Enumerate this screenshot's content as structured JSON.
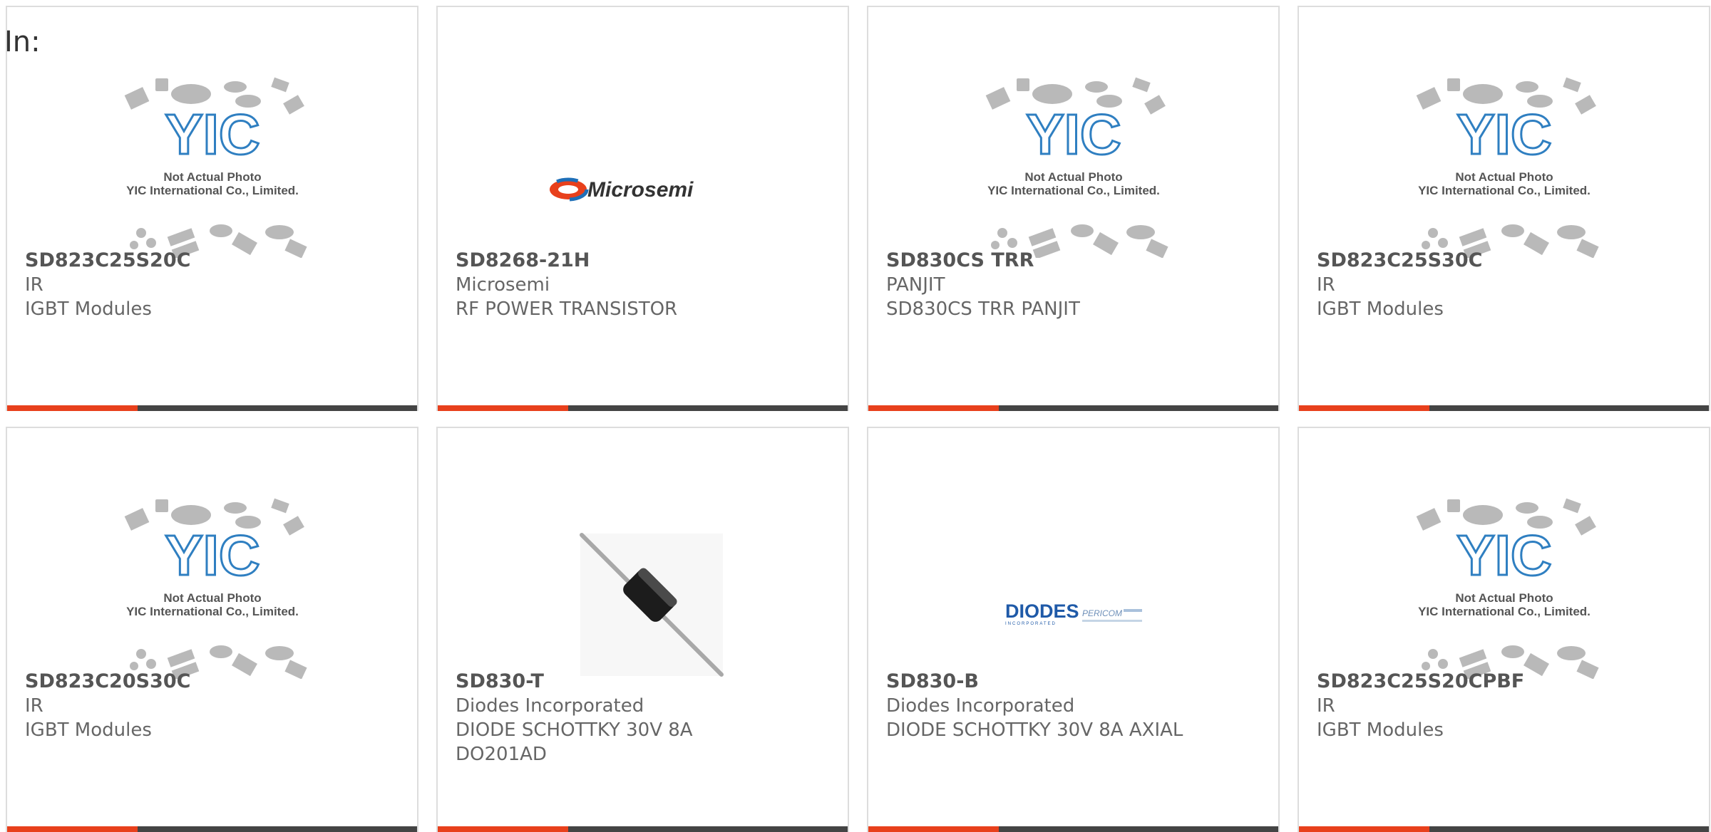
{
  "header": {
    "filter_label": "In:"
  },
  "colors": {
    "accent": "#e8401c",
    "bar": "#444444",
    "border": "#dddddd",
    "text": "#666666"
  },
  "placeholder": {
    "line1": "Not Actual Photo",
    "line2": "YIC International Co., Limited.",
    "logo_text": "YIC"
  },
  "brand_logos": {
    "microsemi": "Microsemi",
    "diodes": "DIODES",
    "diodes_sub": "INCORPORATED",
    "pericom": "PERICOM"
  },
  "products": [
    {
      "part_number": "SD823C25S20C",
      "manufacturer": "IR",
      "description": "IGBT Modules",
      "image": "yic-placeholder"
    },
    {
      "part_number": "SD8268-21H",
      "manufacturer": "Microsemi",
      "description": "RF POWER TRANSISTOR",
      "image": "microsemi-logo"
    },
    {
      "part_number": "SD830CS TRR",
      "manufacturer": "PANJIT",
      "description": "SD830CS TRR PANJIT",
      "image": "yic-placeholder"
    },
    {
      "part_number": "SD823C25S30C",
      "manufacturer": "IR",
      "description": "IGBT Modules",
      "image": "yic-placeholder"
    },
    {
      "part_number": "SD823C20S30C",
      "manufacturer": "IR",
      "description": "IGBT Modules",
      "image": "yic-placeholder"
    },
    {
      "part_number": "SD830-T",
      "manufacturer": "Diodes Incorporated",
      "description": "DIODE SCHOTTKY 30V 8A",
      "description2": "DO201AD",
      "image": "diode-photo"
    },
    {
      "part_number": "SD830-B",
      "manufacturer": "Diodes Incorporated",
      "description": "DIODE SCHOTTKY 30V 8A AXIAL",
      "image": "diodes-logo"
    },
    {
      "part_number": "SD823C25S20CPBF",
      "manufacturer": "IR",
      "description": "IGBT Modules",
      "image": "yic-placeholder"
    }
  ]
}
